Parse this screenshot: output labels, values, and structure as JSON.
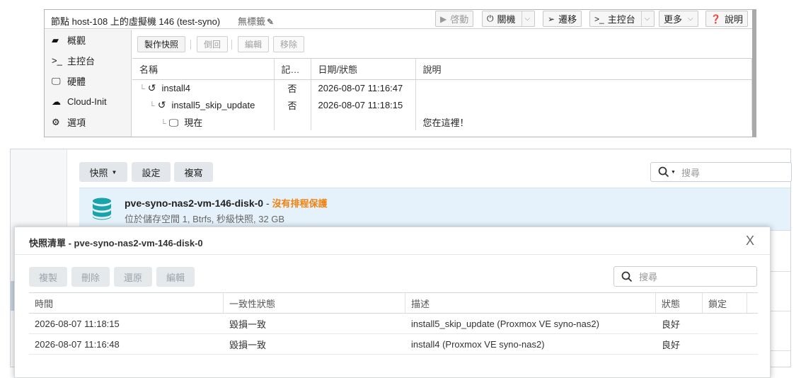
{
  "pve": {
    "title": "節點 host-108 上的虛擬機 146 (test-syno)",
    "tags": "無標籤",
    "buttons": {
      "start": "啓動",
      "shutdown": "關機",
      "migrate": "遷移",
      "console": "主控台",
      "more": "更多",
      "help": "說明"
    },
    "nav": [
      "概觀",
      "主控台",
      "硬體",
      "Cloud-Init",
      "選項"
    ],
    "toolbar": {
      "take_snapshot": "製作快照",
      "rollback": "倒回",
      "edit": "編輯",
      "remove": "移除"
    },
    "columns": [
      "名稱",
      "記憶體",
      "日期/狀態",
      "說明"
    ],
    "rows": [
      {
        "name": "install4",
        "ram": "否",
        "date": "2026-08-07 11:16:47",
        "desc": ""
      },
      {
        "name": "install5_skip_update",
        "ram": "否",
        "date": "2026-08-07 11:18:15",
        "desc": ""
      },
      {
        "name": "現在",
        "ram": "",
        "date": "",
        "desc": "您在這裡！"
      }
    ]
  },
  "dsm": {
    "toolbar": {
      "snapshot": "快照",
      "settings": "設定",
      "copy": "複寫"
    },
    "search_placeholder": "搜尋",
    "volume": {
      "name": "pve-syno-nas2-vm-146-disk-0",
      "separator": " - ",
      "warning": "沒有排程保護",
      "subtitle": "位於儲存空間 1, Btrfs, 秒級快照, 32 GB"
    },
    "dialog": {
      "title": "快照清單 - pve-syno-nas2-vm-146-disk-0",
      "close": "X",
      "buttons": {
        "copy": "複製",
        "delete": "刪除",
        "restore": "還原",
        "edit": "編輯"
      },
      "search_placeholder": "搜尋",
      "columns": [
        "時間",
        "一致性狀態",
        "描述",
        "狀態",
        "鎖定"
      ],
      "rows": [
        {
          "time": "2026-08-07 11:18:15",
          "consistency": "毀損一致",
          "desc": "install5_skip_update (Proxmox VE syno-nas2)",
          "status": "良好",
          "lock": ""
        },
        {
          "time": "2026-08-07 11:16:48",
          "consistency": "毀損一致",
          "desc": "install4 (Proxmox VE syno-nas2)",
          "status": "良好",
          "lock": ""
        }
      ]
    }
  },
  "colors": {
    "accent_warning": "#f0820f",
    "status_ok": "#3a9a1f",
    "selected_row": "#e6f2fb",
    "db_icon": "#1aa3a8"
  }
}
